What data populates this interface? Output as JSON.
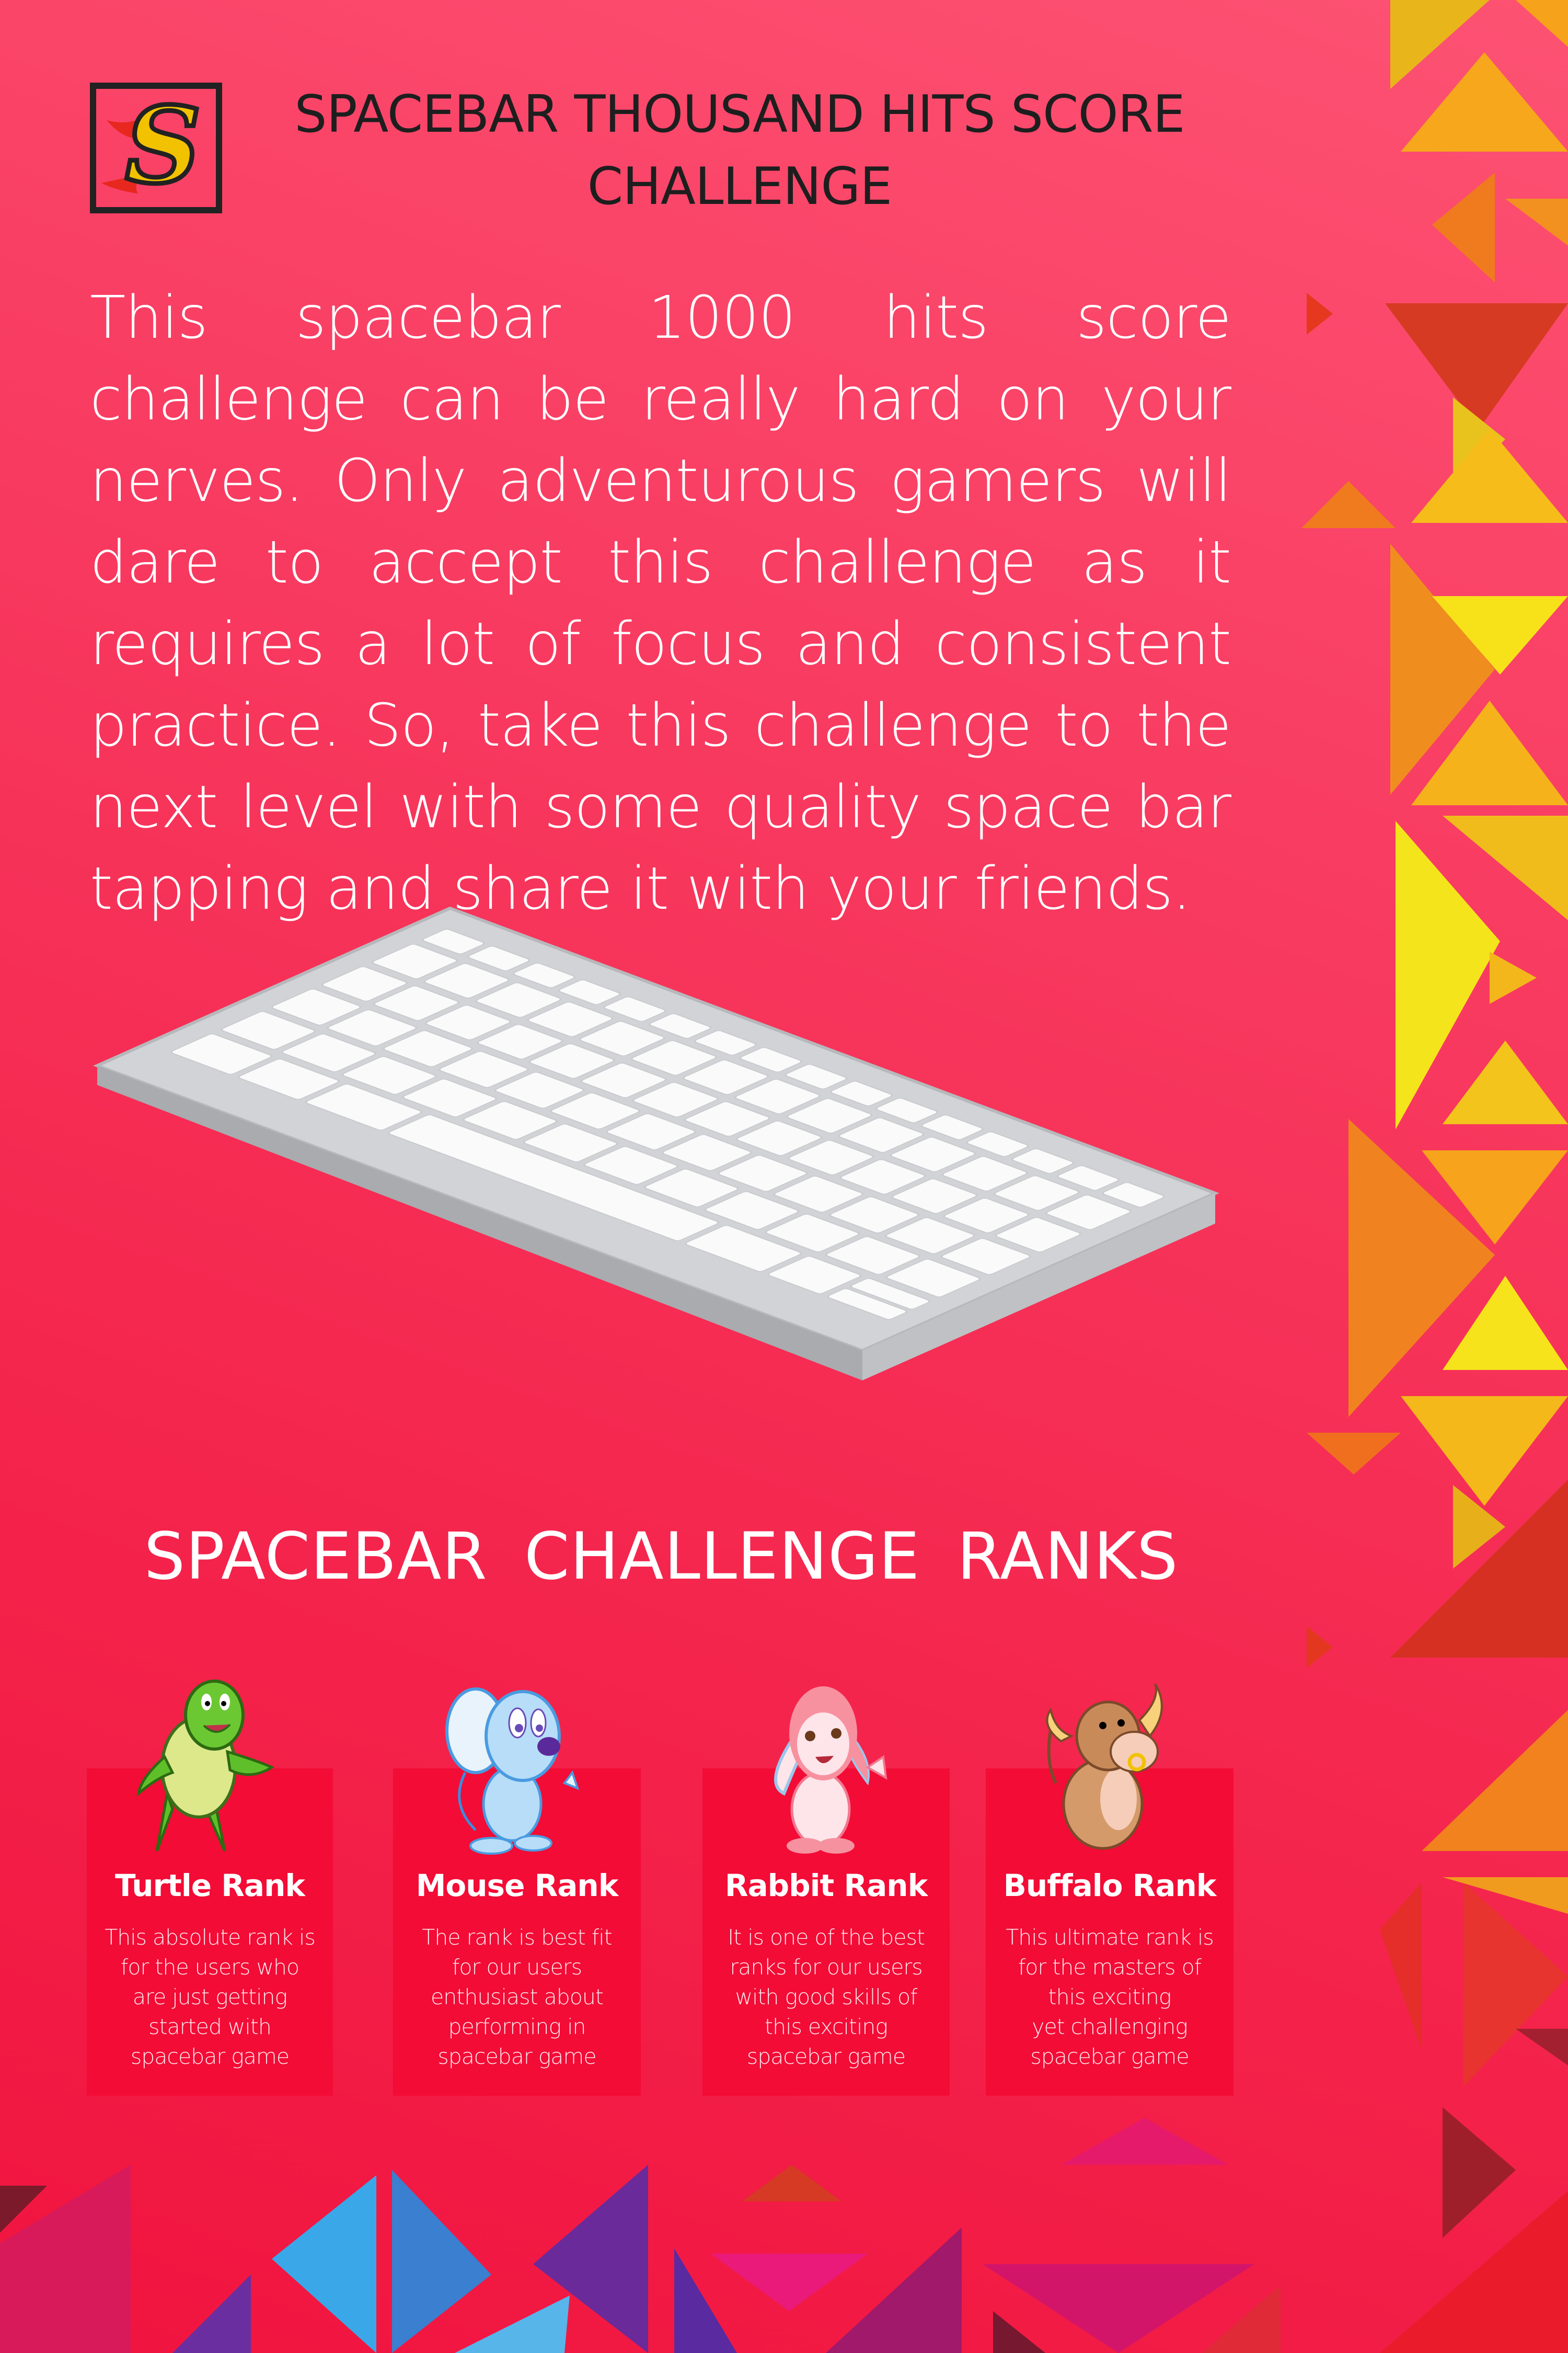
{
  "logo": {
    "letter": "S",
    "colors": {
      "frame": "#222222",
      "letter_fill": "#f2c200",
      "flame": "#e8281e"
    }
  },
  "header": {
    "title": "SPACEBAR THOUSAND HITS SCORE CHALLENGE"
  },
  "intro": "This spacebar 1000 hits score challenge can be really hard on your nerves. Only adventurous gamers will dare to accept this challenge as it requires a lot of focus and consistent practice. So, take this challenge to the next level with some quality space bar tapping and share it with your friends.",
  "ranks": {
    "title": "SPACEBAR CHALLENGE RANKS",
    "items": [
      {
        "name": "Turtle Rank",
        "animal": "turtle",
        "description": "This absolute rank is\nfor the users who\nare just getting\nstarted with\nspacebar game"
      },
      {
        "name": "Mouse Rank",
        "animal": "mouse",
        "description": "The rank is best fit\nfor our users\nenthusiast about\nperforming in\nspacebar game"
      },
      {
        "name": "Rabbit Rank",
        "animal": "rabbit",
        "description": "It is one of the best\nranks for our users\nwith good skills of\nthis exciting\nspacebar game"
      },
      {
        "name": "Buffalo Rank",
        "animal": "buffalo",
        "description": "This ultimate rank is\nfor the masters of\nthis exciting\nyet challenging\nspacebar game"
      }
    ]
  },
  "colors": {
    "background": "#f5294f",
    "card": "#f20c36",
    "title_text": "#1e1e1e"
  }
}
